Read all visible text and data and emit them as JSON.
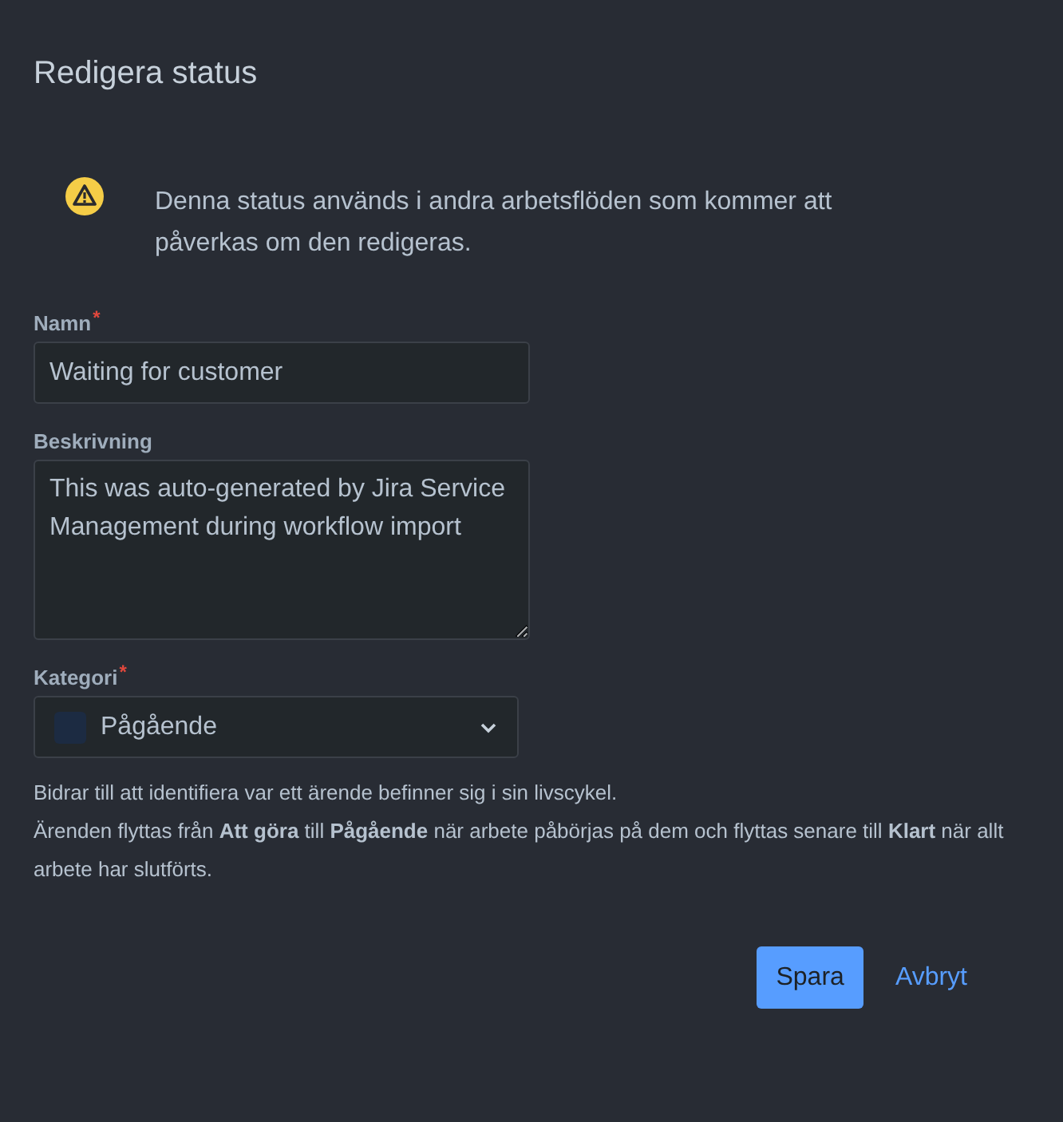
{
  "dialog": {
    "title": "Redigera status"
  },
  "warning": {
    "text": "Denna status används i andra arbetsflöden som kommer att påverkas om den redigeras."
  },
  "fields": [
    {
      "kind": "input",
      "label": "Namn",
      "required_mark": "*",
      "value": "Waiting for customer"
    },
    {
      "kind": "textarea",
      "label": "Beskrivning",
      "value": "This was auto-generated by Jira Service Management during workflow import"
    },
    {
      "kind": "select",
      "label": "Kategori",
      "required_mark": "*",
      "value": "Pågående"
    }
  ],
  "help": [
    "Bidrar till att identifiera var ett ärende befinner sig i sin livscykel.",
    "Ärenden flyttas från **Att göra** till **Pågående** när arbete påbörjas på dem och flyttas senare till **Klart** när allt arbete har slutförts."
  ],
  "buttons": [
    {
      "kind": "primary",
      "label": "Spara"
    },
    {
      "kind": "link",
      "label": "Avbryt"
    }
  ]
}
